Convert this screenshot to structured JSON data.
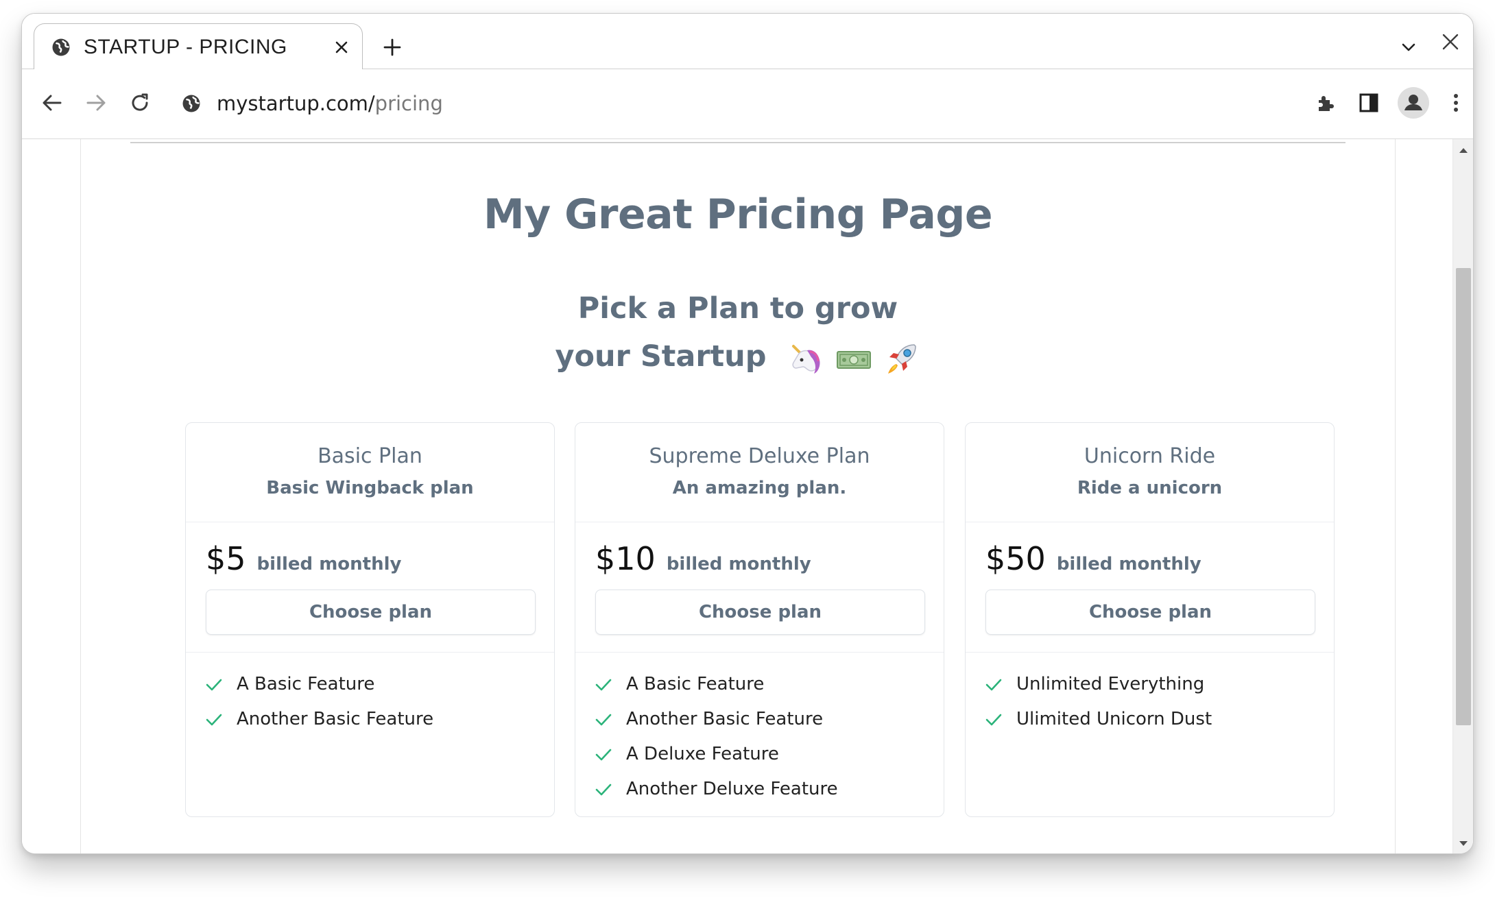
{
  "browser": {
    "tab_title": "STARTUP - PRICING",
    "url_host": "mystartup.com/",
    "url_path": "pricing"
  },
  "page": {
    "title": "My Great Pricing Page",
    "subtitle_line1": "Pick a Plan to grow",
    "subtitle_line2": "your Startup",
    "subtitle_emojis": [
      "unicorn",
      "money",
      "rocket"
    ]
  },
  "plans": [
    {
      "name": "Basic Plan",
      "description": "Basic Wingback plan",
      "price": "$5",
      "billing": "billed monthly",
      "button": "Choose plan",
      "features": [
        "A Basic Feature",
        "Another Basic Feature"
      ]
    },
    {
      "name": "Supreme Deluxe Plan",
      "description": "An amazing plan.",
      "price": "$10",
      "billing": "billed monthly",
      "button": "Choose plan",
      "features": [
        "A Basic Feature",
        "Another Basic Feature",
        "A Deluxe Feature",
        "Another Deluxe Feature"
      ]
    },
    {
      "name": "Unicorn Ride",
      "description": "Ride a unicorn",
      "price": "$50",
      "billing": "billed monthly",
      "button": "Choose plan",
      "features": [
        "Unlimited Everything",
        "Ulimited Unicorn Dust"
      ]
    }
  ],
  "colors": {
    "heading": "#5f6f7f",
    "check": "#2bb37a",
    "accent_rule": "#3f7f6a"
  }
}
